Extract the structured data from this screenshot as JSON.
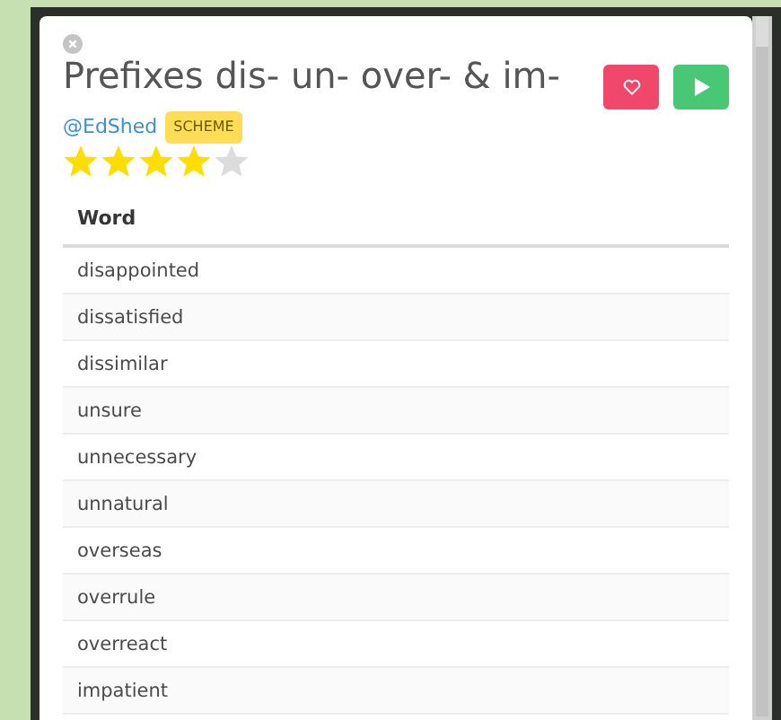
{
  "modal": {
    "title": "Prefixes dis- un- over- & im-",
    "author": "@EdShed",
    "tag": "SCHEME",
    "stars": 4,
    "table": {
      "columns": [
        "Word"
      ],
      "rows": [
        [
          "disappointed"
        ],
        [
          "dissatisfied"
        ],
        [
          "dissimilar"
        ],
        [
          "unsure"
        ],
        [
          "unnecessary"
        ],
        [
          "unnatural"
        ],
        [
          "overseas"
        ],
        [
          "overrule"
        ],
        [
          "overreact"
        ],
        [
          "impatient"
        ]
      ]
    }
  }
}
